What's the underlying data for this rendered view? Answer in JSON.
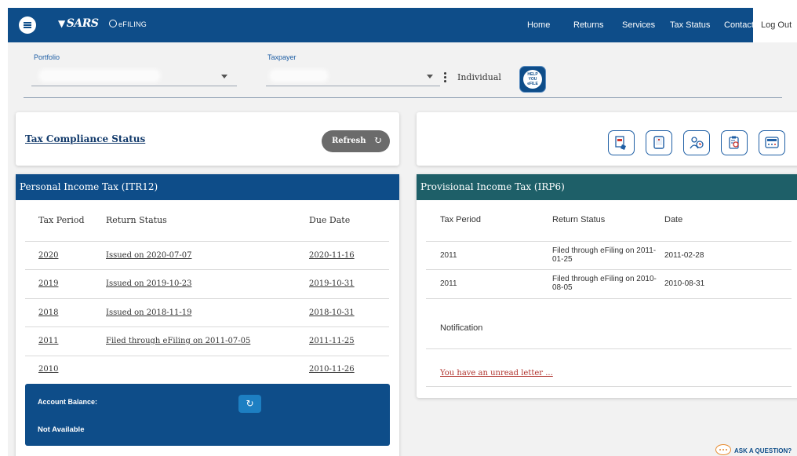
{
  "header": {
    "logo": "SARS",
    "efiling": "eFILING",
    "nav": [
      "Home",
      "Returns",
      "Services",
      "Tax Status",
      "Contact"
    ],
    "logout": "Log Out"
  },
  "selectors": {
    "portfolio_label": "Portfolio",
    "taxpayer_label": "Taxpayer",
    "taxpayer_type": "Individual",
    "help_badge": "HELP YOU eFILE"
  },
  "compliance": {
    "title": "Tax Compliance Status",
    "refresh_label": "Refresh"
  },
  "toolbar": {
    "icons": [
      "document-hand-icon",
      "tablet-device-icon",
      "person-clock-icon",
      "clipboard-gear-icon",
      "calculator-screen-icon"
    ]
  },
  "itr12": {
    "title": "Personal Income Tax (ITR12)",
    "columns": [
      "Tax Period",
      "Return Status",
      "Due Date"
    ],
    "rows": [
      {
        "period": "2020",
        "status": "Issued on 2020-07-07",
        "due": "2020-11-16"
      },
      {
        "period": "2019",
        "status": "Issued on 2019-10-23",
        "due": "2019-10-31"
      },
      {
        "period": "2018",
        "status": "Issued on 2018-11-19",
        "due": "2018-10-31"
      },
      {
        "period": "2011",
        "status": "Filed through eFiling on 2011-07-05",
        "due": "2011-11-25"
      },
      {
        "period": "2010",
        "status": "",
        "due": "2010-11-26"
      }
    ]
  },
  "account": {
    "label": "Account Balance:",
    "value": "Not Available"
  },
  "irp6": {
    "title": "Provisional Income Tax (IRP6)",
    "columns": [
      "Tax Period",
      "Return Status",
      "Date"
    ],
    "rows": [
      {
        "period": "2011",
        "status": "Filed through eFiling on 2011-01-25",
        "date": "2011-02-28"
      },
      {
        "period": "2011",
        "status": "Filed through eFiling on 2010-08-05",
        "date": "2010-08-31"
      }
    ],
    "notification_label": "Notification",
    "notification_link": "You have an unread letter ..."
  },
  "help": {
    "ask_label": "ASK A QUESTION?"
  },
  "colors": {
    "brand_blue": "#0e4d89",
    "irp6_teal": "#1e5f68",
    "link_red": "#b0322c"
  }
}
